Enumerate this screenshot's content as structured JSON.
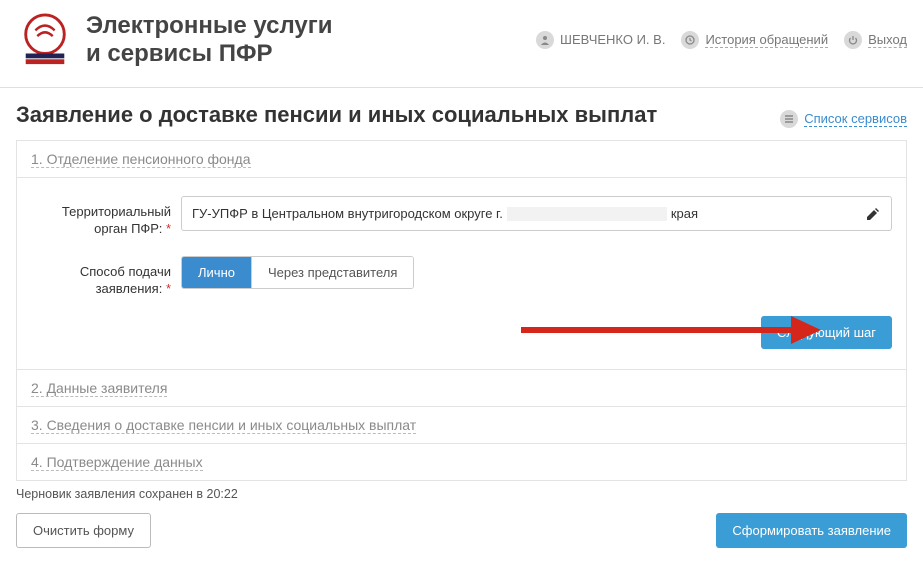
{
  "header": {
    "site_title_line1": "Электронные услуги",
    "site_title_line2": "и сервисы ПФР",
    "user_name": "ШЕВЧЕНКО И. В.",
    "history_label": "История обращений",
    "logout_label": "Выход"
  },
  "page": {
    "title": "Заявление о доставке пенсии и иных социальных выплат",
    "services_link": "Список сервисов"
  },
  "sections": {
    "s1": "1. Отделение пенсионного фонда",
    "s2": "2. Данные заявителя",
    "s3": "3. Сведения о доставке пенсии и иных социальных выплат",
    "s4": "4. Подтверждение данных"
  },
  "form": {
    "territorial_label": "Территориальный орган ПФР:",
    "territorial_value_prefix": "ГУ-УПФР в Центральном внутригородском округе г.",
    "territorial_value_suffix": "края",
    "submission_label": "Способ подачи заявления:",
    "opt_self": "Лично",
    "opt_rep": "Через представителя",
    "next_step": "Следующий шаг"
  },
  "footer": {
    "draft_saved": "Черновик заявления сохранен в 20:22",
    "clear_form": "Очистить форму",
    "submit_form": "Сформировать заявление"
  }
}
